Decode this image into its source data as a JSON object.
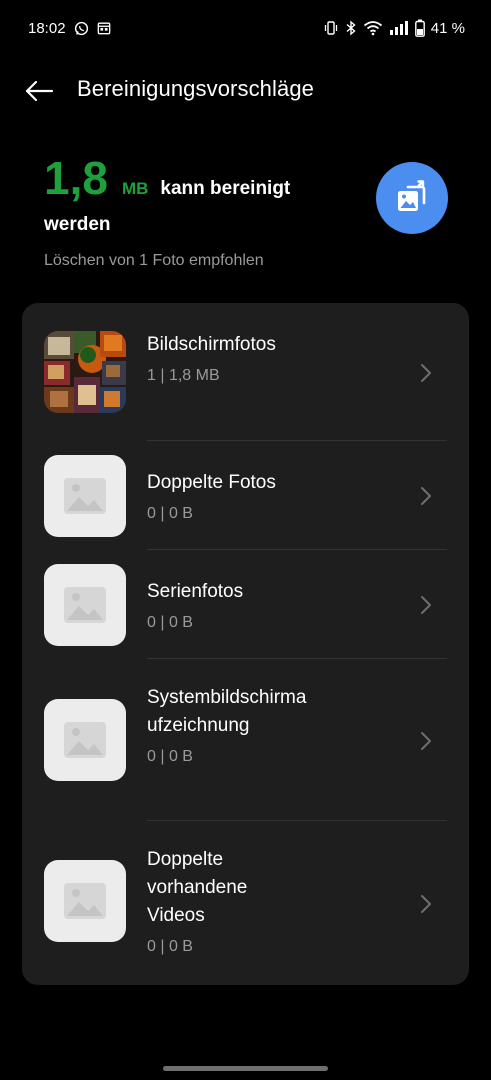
{
  "status_bar": {
    "time": "18:02",
    "battery": "41 %",
    "icons": [
      "whatsapp-icon",
      "calendar-icon",
      "vibrate-icon",
      "bluetooth-icon",
      "wifi-icon",
      "signal-icon",
      "battery-icon"
    ]
  },
  "header": {
    "title": "Bereinigungsvorschläge",
    "back_icon": "arrow-left-icon"
  },
  "summary": {
    "size_value": "1,8",
    "size_unit": "MB",
    "text_line1": "kann bereinigt",
    "text_line2": "werden",
    "subtitle": "Löschen von 1 Foto empfohlen",
    "fab_icon": "photo-clean-icon",
    "accent_color": "#1ea13c",
    "fab_color": "#4b8ef0"
  },
  "items": [
    {
      "title": "Bildschirmfotos",
      "subtitle": "1 | 1,8 MB",
      "thumbnail": "screenshot-collage"
    },
    {
      "title": "Doppelte Fotos",
      "subtitle": "0 | 0 B",
      "thumbnail": "image-placeholder-icon"
    },
    {
      "title": "Serienfotos",
      "subtitle": "0 | 0 B",
      "thumbnail": "image-placeholder-icon"
    },
    {
      "title": "Systembildschirmaufzeichnung",
      "subtitle": "0 | 0 B",
      "thumbnail": "image-placeholder-icon"
    },
    {
      "title": "Doppelte vorhandene Videos",
      "subtitle": "0 | 0 B",
      "thumbnail": "image-placeholder-icon"
    }
  ]
}
